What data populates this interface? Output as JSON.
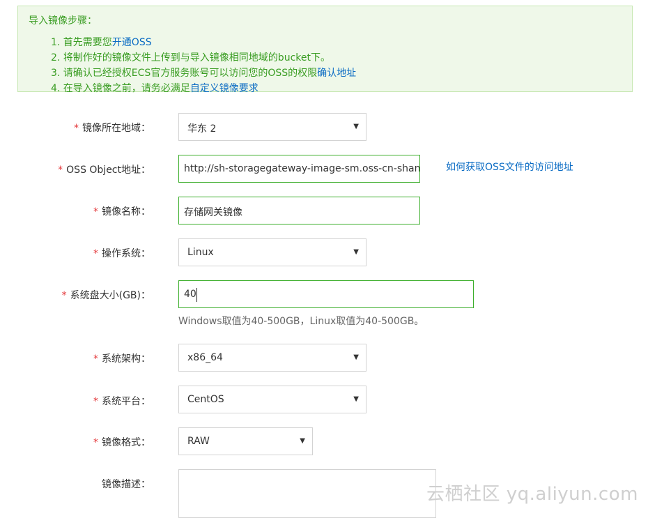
{
  "notice": {
    "title": "导入镜像步骤：",
    "steps": [
      {
        "prefix": "1. 首先需要您",
        "link": "开通OSS",
        "suffix": ""
      },
      {
        "prefix": "2. 将制作好的镜像文件上传到与导入镜像相同地域的bucket下。",
        "link": "",
        "suffix": ""
      },
      {
        "prefix": "3. 请确认已经授权ECS官方服务账号可以访问您的OSS的权限",
        "link": "确认地址",
        "suffix": ""
      },
      {
        "prefix": "4. 在导入镜像之前，请务必满足",
        "link": "自定义镜像要求",
        "suffix": ""
      }
    ]
  },
  "form": {
    "required_mark": "*",
    "region": {
      "label": "镜像所在地域：",
      "value": "华东 2"
    },
    "oss_url": {
      "label": "OSS Object地址：",
      "value": "http://sh-storagegateway-image-sm.oss-cn-shanghai",
      "help_link": "如何获取OSS文件的访问地址"
    },
    "image_name": {
      "label": "镜像名称：",
      "value": "存储网关镜像"
    },
    "os": {
      "label": "操作系统：",
      "value": "Linux"
    },
    "disk_size": {
      "label": "系统盘大小(GB)：",
      "value": "40",
      "hint": "Windows取值为40-500GB，Linux取值为40-500GB。"
    },
    "arch": {
      "label": "系统架构：",
      "value": "x86_64"
    },
    "platform": {
      "label": "系统平台：",
      "value": "CentOS"
    },
    "format": {
      "label": "镜像格式：",
      "value": "RAW"
    },
    "description": {
      "label": "镜像描述：",
      "value": ""
    }
  },
  "icons": {
    "caret": "caret-down-icon"
  },
  "watermark": "云栖社区 yq.aliyun.com",
  "colors": {
    "accent_green": "#3a9d23",
    "notice_bg": "#eff8e9",
    "link_blue": "#0b6cc4",
    "required_red": "#e4393c"
  }
}
